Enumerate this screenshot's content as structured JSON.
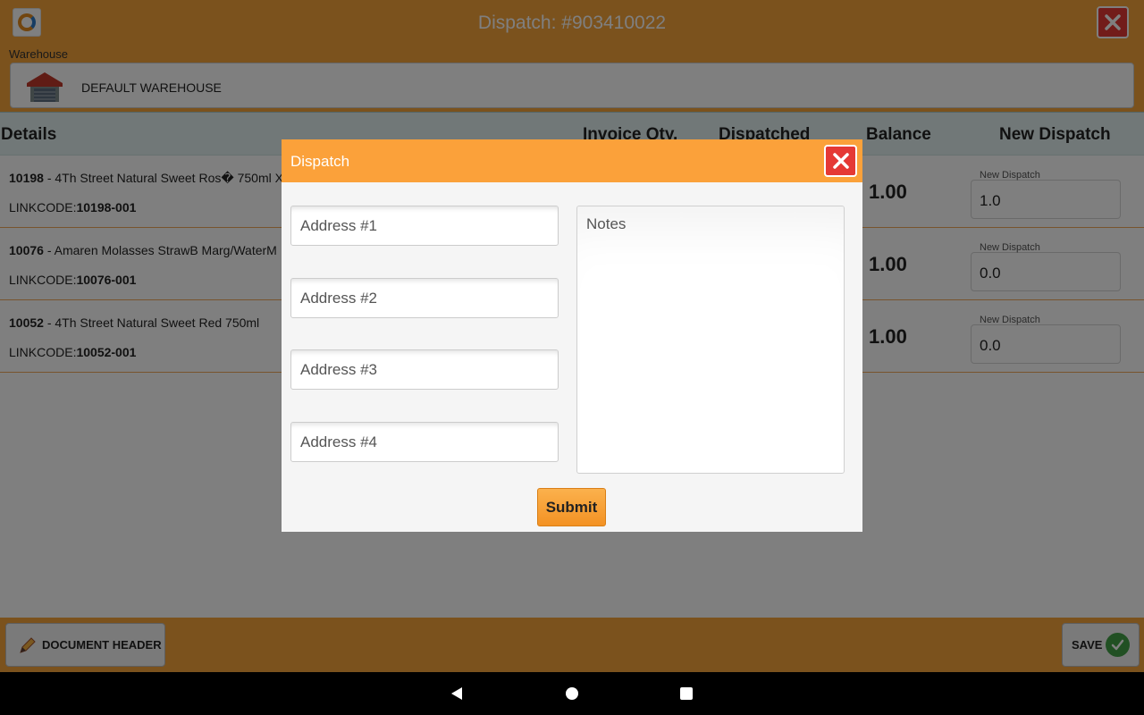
{
  "header": {
    "title": "Dispatch: #903410022",
    "warehouse_label": "Warehouse",
    "warehouse_name": "DEFAULT WAREHOUSE"
  },
  "table": {
    "columns": {
      "details": "Details",
      "invoice_qty": "Invoice Qty.",
      "dispatched": "Dispatched",
      "balance": "Balance",
      "new_dispatch": "New Dispatch"
    },
    "rows": [
      {
        "code": "10198",
        "description": " - 4Th Street Natural Sweet Ros� 750ml X",
        "linkcode_label": "LINKCODE:",
        "linkcode": "10198-001",
        "balance": "1.00",
        "new_dispatch_label": "New Dispatch",
        "new_dispatch_value": "1.0"
      },
      {
        "code": "10076",
        "description": " - Amaren Molasses StrawB Marg/WaterM",
        "linkcode_label": "LINKCODE:",
        "linkcode": "10076-001",
        "balance": "1.00",
        "new_dispatch_label": "New Dispatch",
        "new_dispatch_value": "0.0"
      },
      {
        "code": "10052",
        "description": " - 4Th Street Natural Sweet Red 750ml",
        "linkcode_label": "LINKCODE:",
        "linkcode": "10052-001",
        "balance": "1.00",
        "new_dispatch_label": "New Dispatch",
        "new_dispatch_value": "0.0"
      }
    ]
  },
  "footer": {
    "document_header_label": "DOCUMENT HEADER",
    "save_label": "SAVE"
  },
  "modal": {
    "title": "Dispatch",
    "address1_placeholder": "Address #1",
    "address2_placeholder": "Address #2",
    "address3_placeholder": "Address #3",
    "address4_placeholder": "Address #4",
    "notes_placeholder": "Notes",
    "submit_label": "Submit"
  },
  "icons": {
    "close": "close-icon",
    "warehouse": "warehouse-icon",
    "edit": "pencil-icon",
    "save": "check-icon",
    "nav_back": "back-icon",
    "nav_home": "home-icon",
    "nav_recent": "recent-apps-icon"
  },
  "colors": {
    "accent": "#f7a43a",
    "close_button": "#e53935",
    "save_check": "#43a047"
  }
}
